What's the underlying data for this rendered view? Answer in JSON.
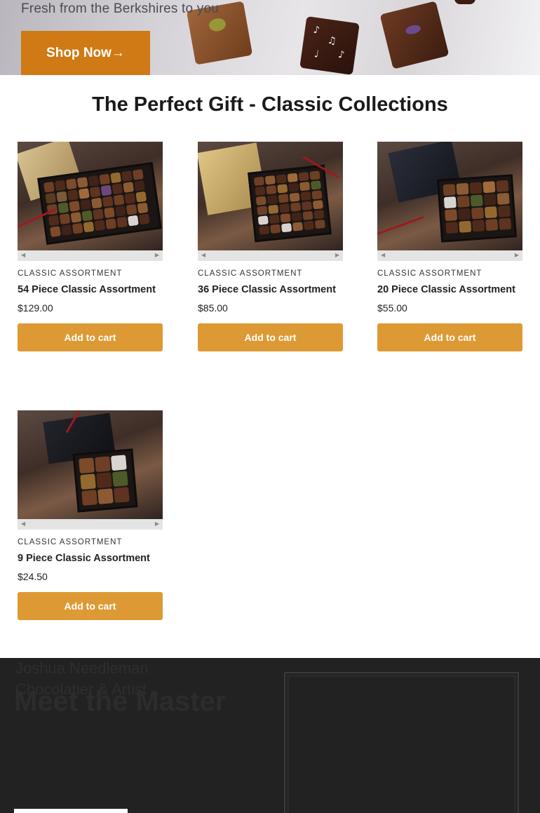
{
  "hero": {
    "subtitle": "Fresh from the Berkshires to you",
    "button_label": "Shop Now→"
  },
  "section": {
    "title": "The Perfect Gift - Classic Collections"
  },
  "products": [
    {
      "category": "CLASSIC ASSORTMENT",
      "name": "54 Piece Classic Assortment",
      "price": "$129.00",
      "button": "Add to cart"
    },
    {
      "category": "CLASSIC ASSORTMENT",
      "name": "36 Piece Classic Assortment",
      "price": "$85.00",
      "button": "Add to cart"
    },
    {
      "category": "CLASSIC ASSORTMENT",
      "name": "20 Piece Classic Assortment",
      "price": "$55.00",
      "button": "Add to cart"
    },
    {
      "category": "CLASSIC ASSORTMENT",
      "name": "9 Piece Classic Assortment",
      "price": "$24.50",
      "button": "Add to cart"
    }
  ],
  "master": {
    "name": "Joshua Needleman",
    "role": "Chocolatier & Artist",
    "title": "Meet the Master"
  },
  "colors": {
    "accent_dark": "#cf7a14",
    "accent_button": "#dd9a34",
    "dark_bg": "#222222"
  }
}
